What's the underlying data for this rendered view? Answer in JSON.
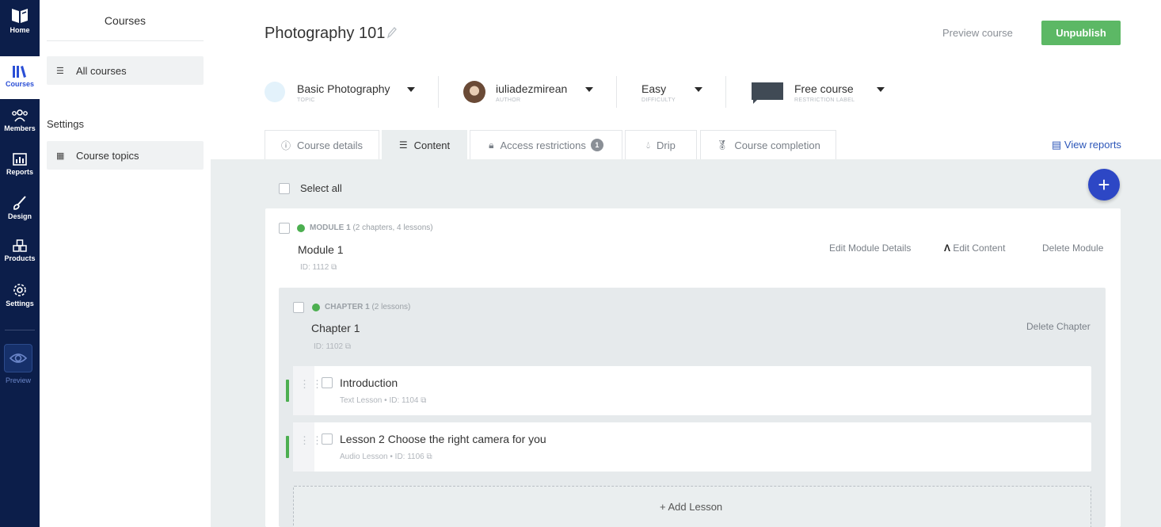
{
  "nav": {
    "home": "Home",
    "courses": "Courses",
    "members": "Members",
    "reports": "Reports",
    "design": "Design",
    "products": "Products",
    "settings": "Settings",
    "preview": "Preview"
  },
  "sidebar": {
    "title": "Courses",
    "all_courses": "All courses",
    "settings_heading": "Settings",
    "course_topics": "Course topics"
  },
  "header": {
    "title": "Photography 101",
    "preview_course": "Preview course",
    "unpublish": "Unpublish"
  },
  "meta": {
    "topic": "Basic Photography",
    "topic_label": "TOPIC",
    "author": "iuliadezmirean",
    "author_label": "AUTHOR",
    "difficulty": "Easy",
    "difficulty_label": "DIFFICULTY",
    "restriction": "Free course",
    "restriction_label": "RESTRICTION LABEL"
  },
  "tabs": {
    "course_details": "Course details",
    "content": "Content",
    "access_restrictions": "Access restrictions",
    "access_restrictions_count": "1",
    "drip": "Drip",
    "course_completion": "Course completion",
    "active": "Content"
  },
  "view_reports": "View reports",
  "select_all": "Select all",
  "module": {
    "tag": "MODULE 1",
    "count": "(2 chapters, 4 lessons)",
    "name": "Module 1",
    "id": "ID: 1112",
    "edit_details": "Edit Module Details",
    "edit_content": "Edit Content",
    "delete": "Delete Module"
  },
  "chapter": {
    "tag": "CHAPTER 1",
    "count": "(2 lessons)",
    "name": "Chapter 1",
    "id": "ID: 1102",
    "delete": "Delete Chapter"
  },
  "lessons": [
    {
      "name": "Introduction",
      "type": "Text Lesson",
      "id": "ID: 1104"
    },
    {
      "name": "Lesson 2 Choose the right camera for you",
      "type": "Audio Lesson",
      "id": "ID: 1106"
    }
  ],
  "add_lesson": "+ Add Lesson",
  "colors": {
    "nav_bg": "#0c1e4a",
    "unpublish": "#5cb865",
    "status_dot": "#4caf50",
    "fab": "#2d47c5",
    "link": "#2c56b8"
  }
}
